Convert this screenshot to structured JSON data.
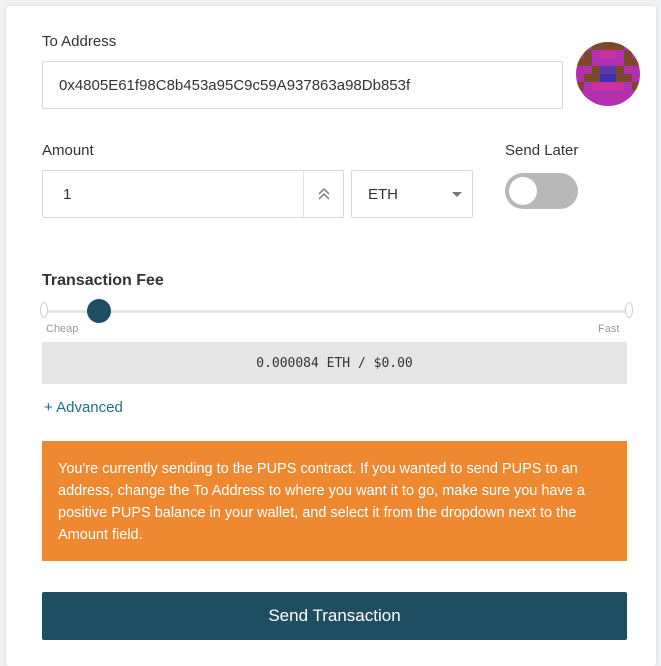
{
  "to_address": {
    "label": "To Address",
    "value": "0x4805E61f98C8b453a95C9c59A937863a98Db853f"
  },
  "amount": {
    "label": "Amount",
    "value": "1",
    "unit": "ETH"
  },
  "send_later": {
    "label": "Send Later",
    "enabled": false
  },
  "transaction_fee": {
    "label": "Transaction Fee",
    "min_label": "Cheap",
    "max_label": "Fast",
    "slider_position_fraction": 0.09,
    "display": "0.000084 ETH / $0.00"
  },
  "advanced_link": "+ Advanced",
  "warning": "You're currently sending to the PUPS contract. If you wanted to send PUPS to an address, change the To Address to where you want it to go, make sure you have a positive PUPS balance in your wallet, and select it from the dropdown next to the Amount field.",
  "send_button": "Send Transaction",
  "colors": {
    "primary": "#1f4e61",
    "warning": "#ee8932",
    "link": "#1f6f84"
  }
}
